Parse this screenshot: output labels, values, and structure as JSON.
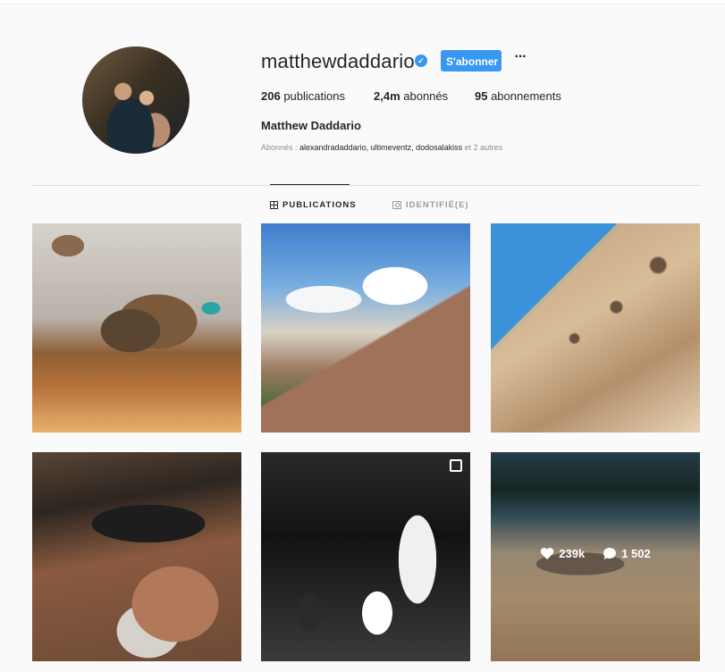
{
  "profile": {
    "username": "matthewdaddario",
    "verified_mark": "✓",
    "follow_label": "S'abonner",
    "more_label": "···",
    "stats": {
      "posts_count": "206",
      "posts_label": " publications",
      "followers_count": "2,4m",
      "followers_label": " abonnés",
      "following_count": "95",
      "following_label": " abonnements"
    },
    "full_name": "Matthew Daddario",
    "followed_by": {
      "prefix": "Abonnés : ",
      "accounts": "alexandradaddario, ultimeventz, dodosalakiss",
      "suffix": " et 2 autres"
    }
  },
  "tabs": {
    "publications": "PUBLICATIONS",
    "tagged": "IDENTIFIÉ(E)"
  },
  "hover_post": {
    "likes": "239k",
    "comments": "1 502"
  },
  "colors": {
    "accent": "#3897f0",
    "text": "#262626",
    "muted": "#8e8e8e",
    "background": "#fafafa"
  },
  "icons": {
    "verified": "verified-badge-icon",
    "more": "more-options-icon",
    "grid": "grid-icon",
    "tagged": "tagged-icon",
    "carousel": "carousel-icon",
    "heart": "heart-icon",
    "comment": "comment-icon"
  }
}
